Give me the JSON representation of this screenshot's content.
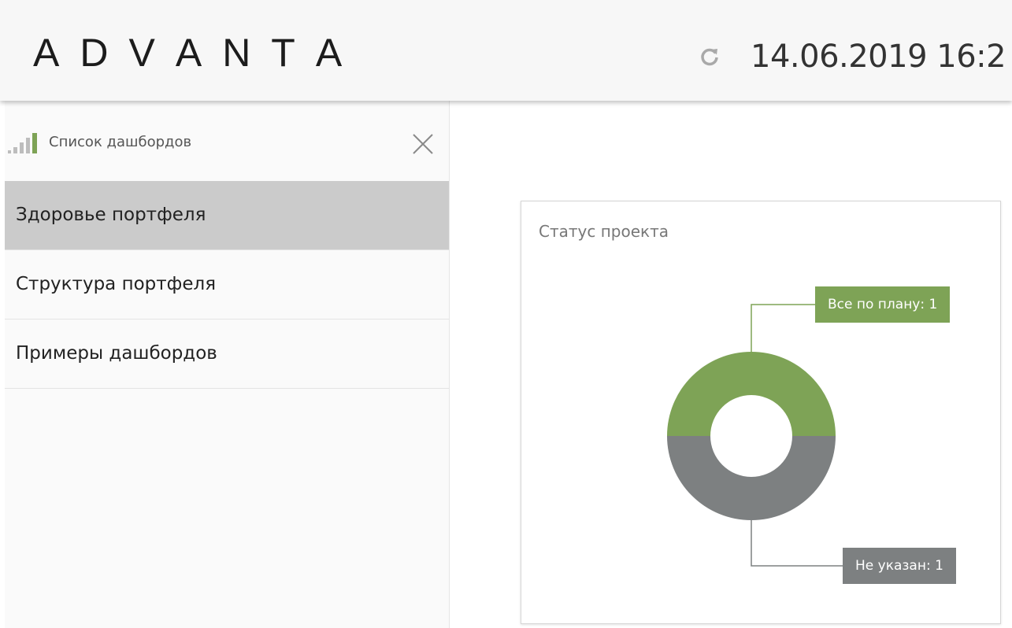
{
  "header": {
    "logo_letters": [
      "A",
      "D",
      "V",
      "A",
      "N",
      "T",
      "A"
    ],
    "datetime": "14.06.2019 16:2"
  },
  "colors": {
    "logo_yellow": "#f4b400",
    "logo_red": "#e0302b",
    "logo_blue": "#3f78c9"
  },
  "icons": {
    "refresh": "refresh-icon",
    "chart": "bar-chart-icon",
    "close": "close-icon"
  },
  "sidebar": {
    "title": "Список дашбордов",
    "items": [
      {
        "label": "Здоровье портфеля",
        "active": true
      },
      {
        "label": "Структура портфеля",
        "active": false
      },
      {
        "label": "Примеры дашбордов",
        "active": false
      }
    ]
  },
  "widget": {
    "title": "Статус проекта",
    "chart_data": {
      "type": "pie",
      "title": "Статус проекта",
      "series": [
        {
          "name": "Все по плану",
          "label": "Все по плану: 1",
          "value": 1,
          "color": "#7ea356"
        },
        {
          "name": "Не указан",
          "label": "Не указан: 1",
          "value": 1,
          "color": "#7d8081"
        }
      ]
    }
  }
}
